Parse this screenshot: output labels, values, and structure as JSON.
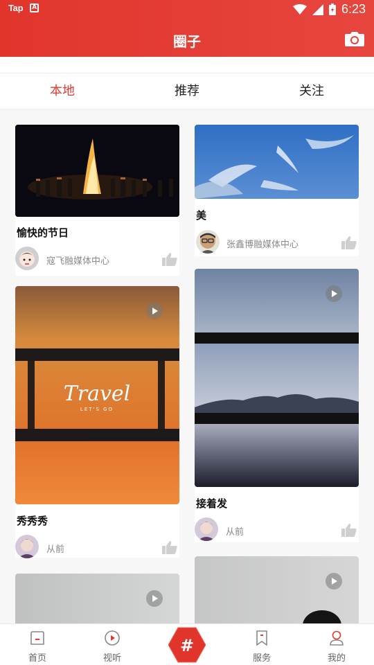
{
  "status_bar": {
    "time": "6:23",
    "app_icon_1": "Tap",
    "app_icon_2": "A"
  },
  "header": {
    "title": "圈子"
  },
  "tabs": [
    {
      "label": "本地",
      "active": true
    },
    {
      "label": "推荐",
      "active": false
    },
    {
      "label": "关注",
      "active": false
    }
  ],
  "feed": {
    "cards": [
      {
        "title": "愉快的节日",
        "author": "寇飞融媒体中心",
        "has_video": false
      },
      {
        "title": "美",
        "author": "张鑫博融媒体中心",
        "has_video": false
      },
      {
        "title": "秀秀秀",
        "author": "从前",
        "has_video": true,
        "thumb_text": "Travel",
        "thumb_subtext": "LET'S GO"
      },
      {
        "title": "接着发",
        "author": "从前",
        "has_video": true
      },
      {
        "title": "",
        "author": "",
        "has_video": true
      },
      {
        "title": "",
        "author": "",
        "has_video": true
      }
    ]
  },
  "bottom_nav": [
    {
      "label": "首页",
      "icon": "home-icon"
    },
    {
      "label": "视听",
      "icon": "play-circle-icon"
    },
    {
      "label": "",
      "icon": "hashtag-icon"
    },
    {
      "label": "服务",
      "icon": "bookmark-icon"
    },
    {
      "label": "我的",
      "icon": "user-icon"
    }
  ],
  "colors": {
    "brand": "#e1352c",
    "active_tab": "#e03a2f",
    "muted": "#8a8a8a"
  }
}
